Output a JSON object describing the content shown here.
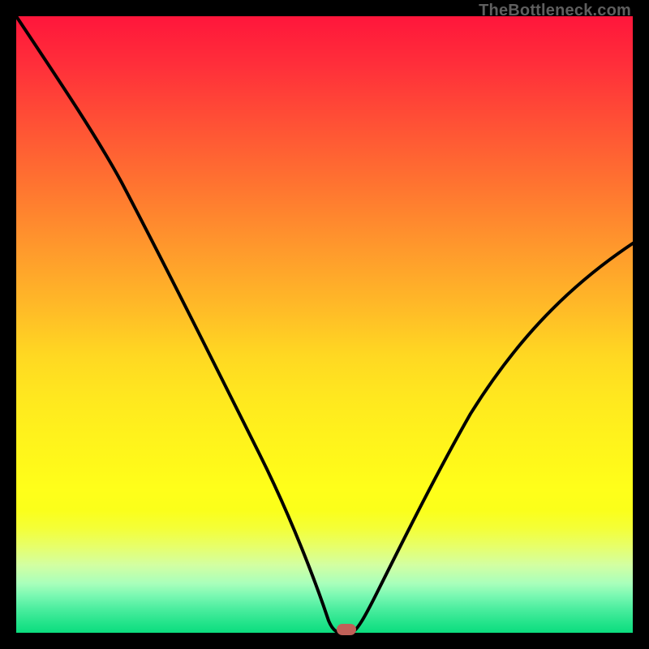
{
  "watermark": "TheBottleneck.com",
  "colors": {
    "frame": "#000000",
    "curve": "#000000",
    "marker": "#c06058"
  },
  "chart_data": {
    "type": "line",
    "title": "",
    "xlabel": "",
    "ylabel": "",
    "xlim": [
      0,
      100
    ],
    "ylim": [
      0,
      100
    ],
    "x": [
      0,
      5,
      10,
      15,
      20,
      25,
      30,
      35,
      40,
      45,
      48,
      50,
      52,
      53,
      55,
      60,
      65,
      70,
      75,
      80,
      85,
      90,
      95,
      100
    ],
    "values": [
      100,
      92,
      84,
      75,
      67,
      58,
      49,
      40,
      30,
      18,
      7,
      2,
      0,
      0,
      2,
      9,
      17,
      25,
      33,
      41,
      48,
      54,
      59,
      63
    ],
    "minimum_at_x": 52.5,
    "minimum_value": 0,
    "background": "rainbow-gradient-red-top-green-bottom"
  }
}
